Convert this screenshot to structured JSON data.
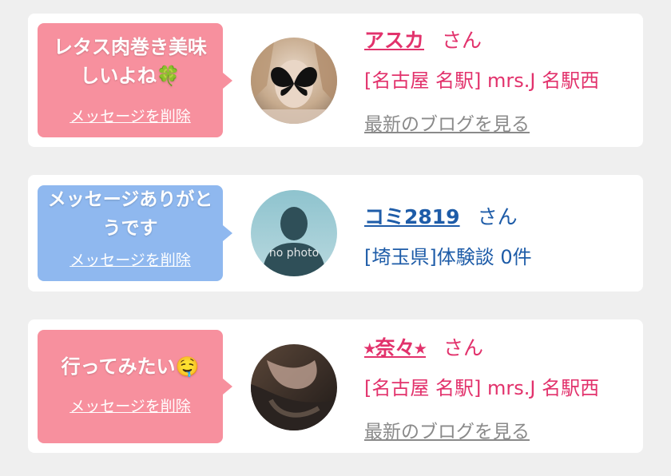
{
  "messages": [
    {
      "bubble_text": "レタス肉巻き美味しいよね🍀",
      "delete_label": "メッセージを削除",
      "user_name": "アスカ",
      "honorific": "さん",
      "area_text": "[名古屋 名駅] mrs.J 名駅西",
      "blog_link": "最新のブログを見る",
      "theme": "pink"
    },
    {
      "bubble_text": "メッセージありがとうです",
      "delete_label": "メッセージを削除",
      "user_name": "コミ2819",
      "honorific": "さん",
      "area_text": "[埼玉県]体験談 0件",
      "avatar_placeholder": "no photo",
      "theme": "blue"
    },
    {
      "bubble_text": "行ってみたい🤤",
      "delete_label": "メッセージを削除",
      "user_name": "⭑奈々⭑",
      "honorific": "さん",
      "area_text": "[名古屋 名駅] mrs.J 名駅西",
      "blog_link": "最新のブログを見る",
      "theme": "pink"
    }
  ],
  "colors": {
    "pink_bubble": "#f7909e",
    "blue_bubble": "#8fb8ef",
    "pink_text": "#e2326c",
    "blue_text": "#1e5ca8",
    "link_gray": "#8a8a8a",
    "background": "#efefef"
  }
}
